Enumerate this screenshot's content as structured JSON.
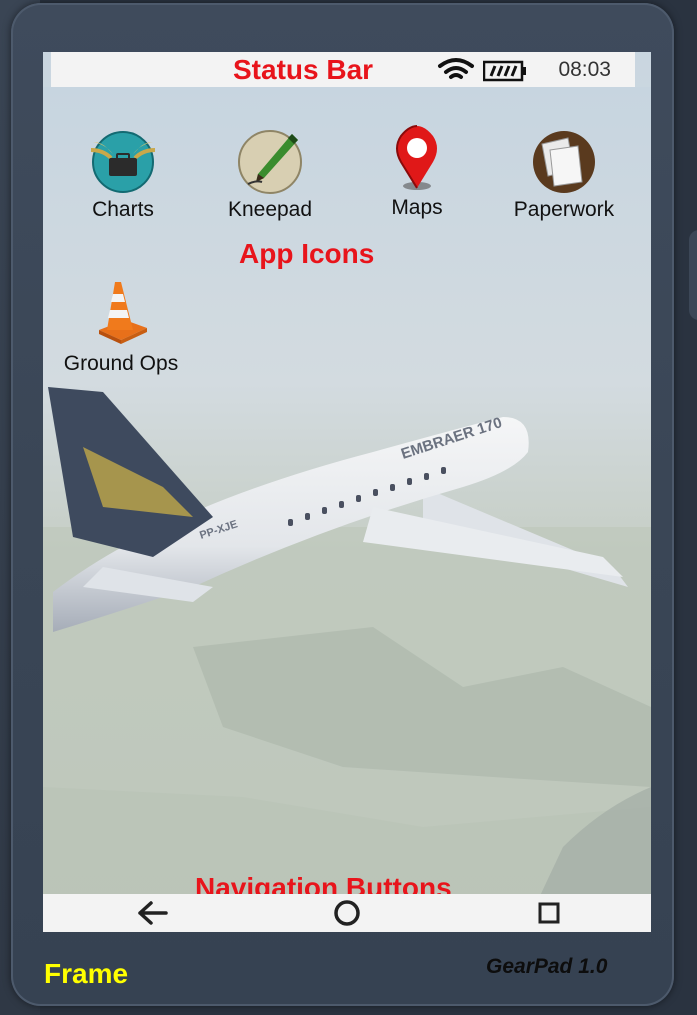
{
  "status_bar": {
    "annotation": "Status Bar",
    "time": "08:03",
    "wifi_icon": "wifi-icon",
    "battery_icon": "battery-icon"
  },
  "apps": [
    {
      "label": "Charts",
      "icon": "charts-icon"
    },
    {
      "label": "Kneepad",
      "icon": "kneepad-icon"
    },
    {
      "label": "Maps",
      "icon": "map-pin-icon"
    },
    {
      "label": "Paperwork",
      "icon": "paperwork-icon"
    },
    {
      "label": "Ground Ops",
      "icon": "traffic-cone-icon"
    }
  ],
  "annotations": {
    "app_icons": "App Icons",
    "navigation_buttons": "Navigation Buttons",
    "frame": "Frame"
  },
  "wallpaper": {
    "aircraft_text": "EMBRAER 170",
    "registration": "PP-XJE"
  },
  "navigation": {
    "back_icon": "back-arrow-icon",
    "home_icon": "home-circle-icon",
    "recents_icon": "recents-square-icon"
  },
  "brand": "GearPad 1.0",
  "colors": {
    "annotation_red": "#e8141b",
    "frame_label_yellow": "#ffff00",
    "device_frame": "#3a4656",
    "bar_bg": "#f3f3f3"
  }
}
